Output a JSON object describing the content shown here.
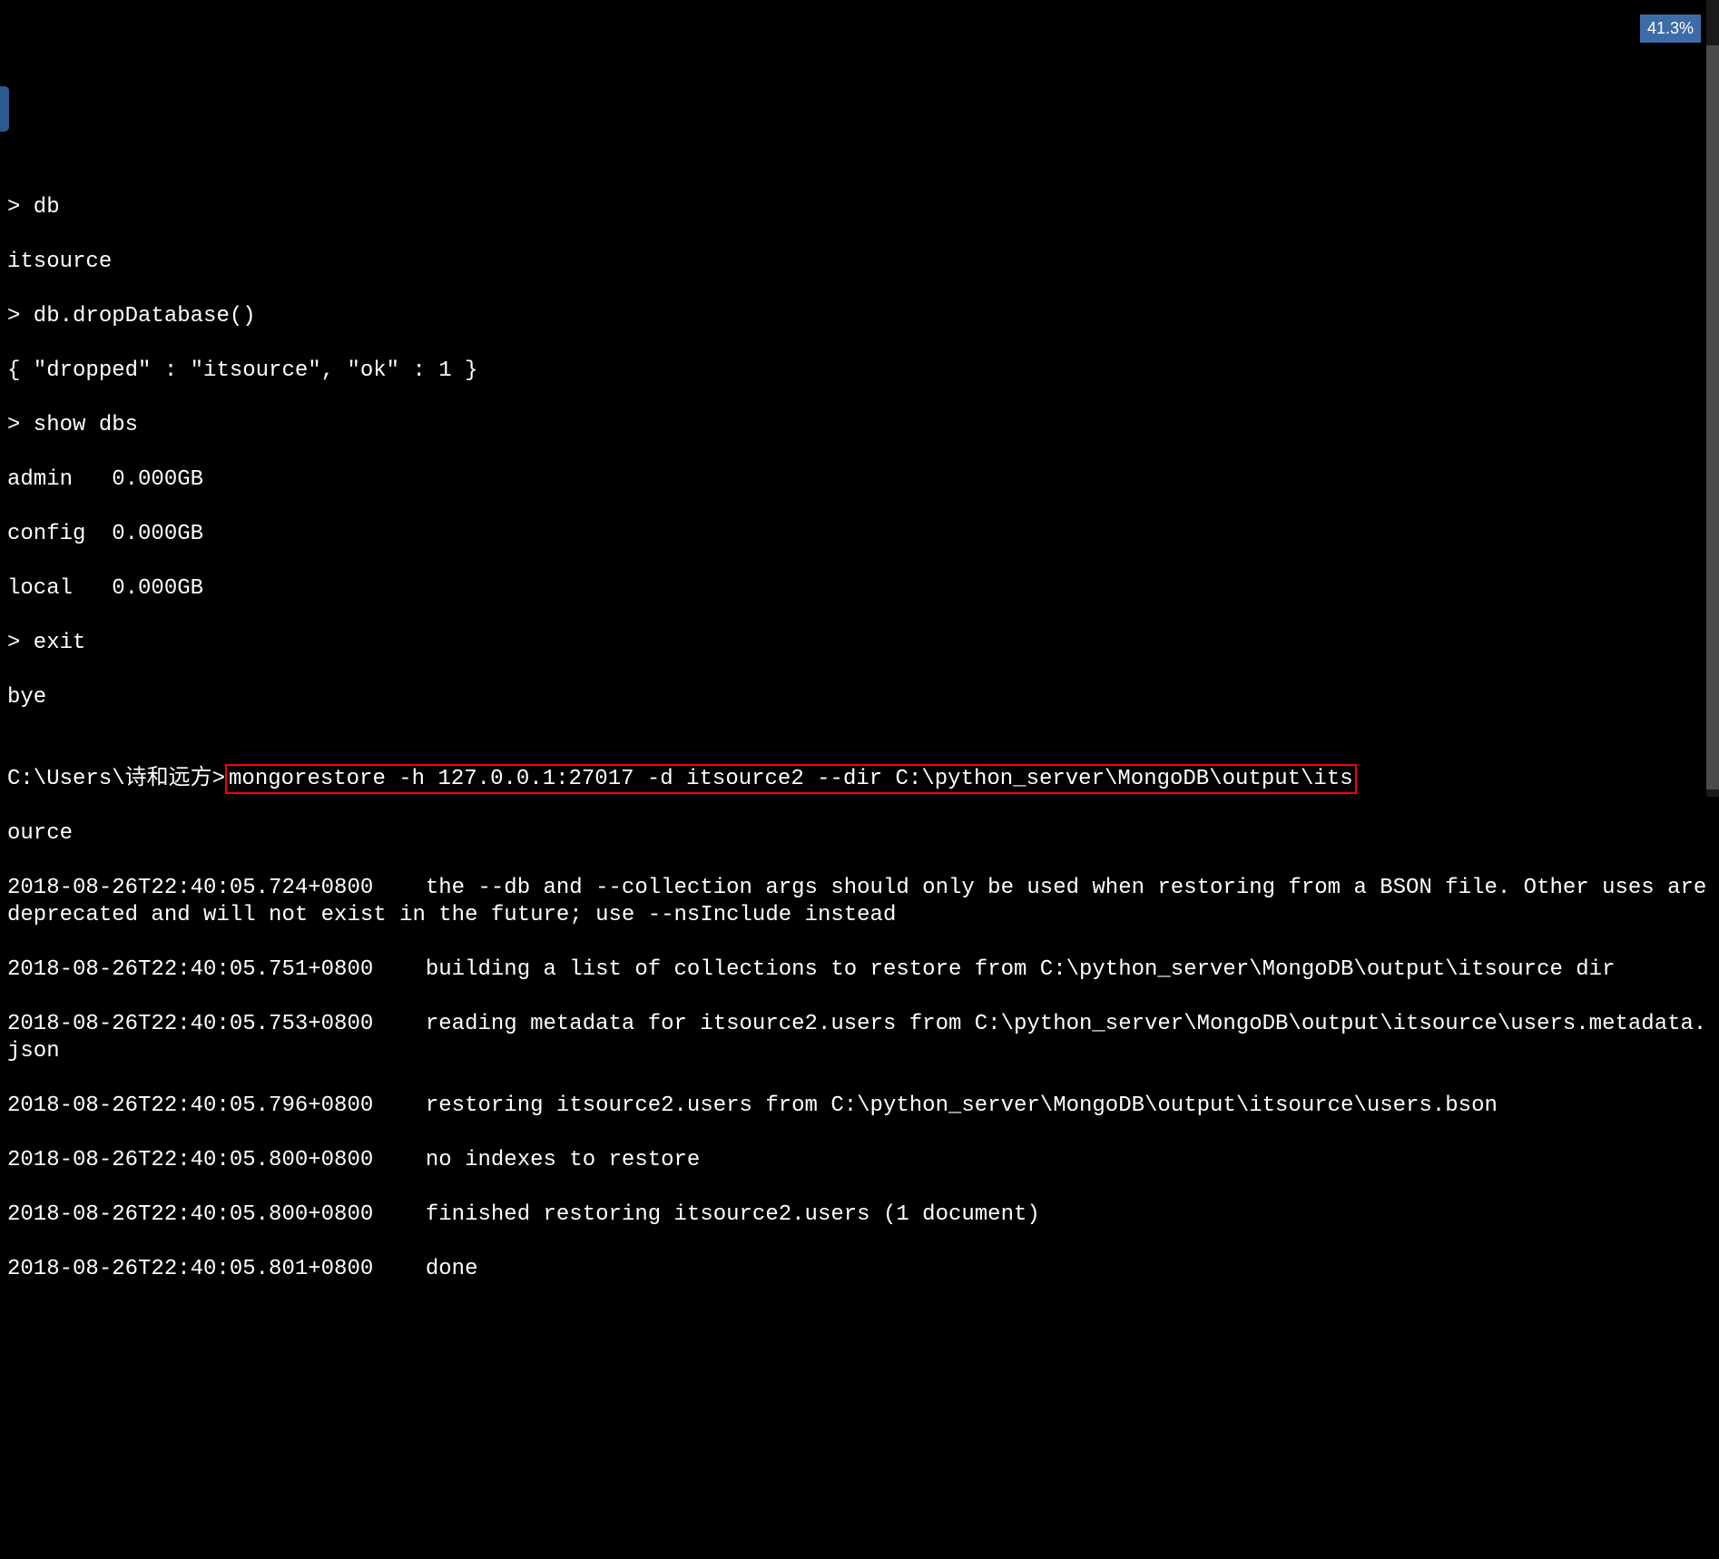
{
  "zoom_percent": "41.3%",
  "terminal": {
    "lines": [
      "> db",
      "itsource",
      "> db.dropDatabase()",
      "{ \"dropped\" : \"itsource\", \"ok\" : 1 }",
      "> show dbs",
      "admin   0.000GB",
      "config  0.000GB",
      "local   0.000GB",
      "> exit",
      "bye",
      "",
      {
        "prefix": "C:\\Users\\诗和远方>",
        "highlighted": "mongorestore -h 127.0.0.1:27017 -d itsource2 --dir C:\\python_server\\MongoDB\\output\\its"
      },
      "ource",
      "2018-08-26T22:40:05.724+0800    the --db and --collection args should only be used when restoring from a BSON file. Other uses are deprecated and will not exist in the future; use --nsInclude instead",
      "2018-08-26T22:40:05.751+0800    building a list of collections to restore from C:\\python_server\\MongoDB\\output\\itsource dir",
      "2018-08-26T22:40:05.753+0800    reading metadata for itsource2.users from C:\\python_server\\MongoDB\\output\\itsource\\users.metadata.json",
      "2018-08-26T22:40:05.796+0800    restoring itsource2.users from C:\\python_server\\MongoDB\\output\\itsource\\users.bson",
      "2018-08-26T22:40:05.800+0800    no indexes to restore",
      "2018-08-26T22:40:05.800+0800    finished restoring itsource2.users (1 document)",
      "2018-08-26T22:40:05.801+0800    done"
    ]
  }
}
